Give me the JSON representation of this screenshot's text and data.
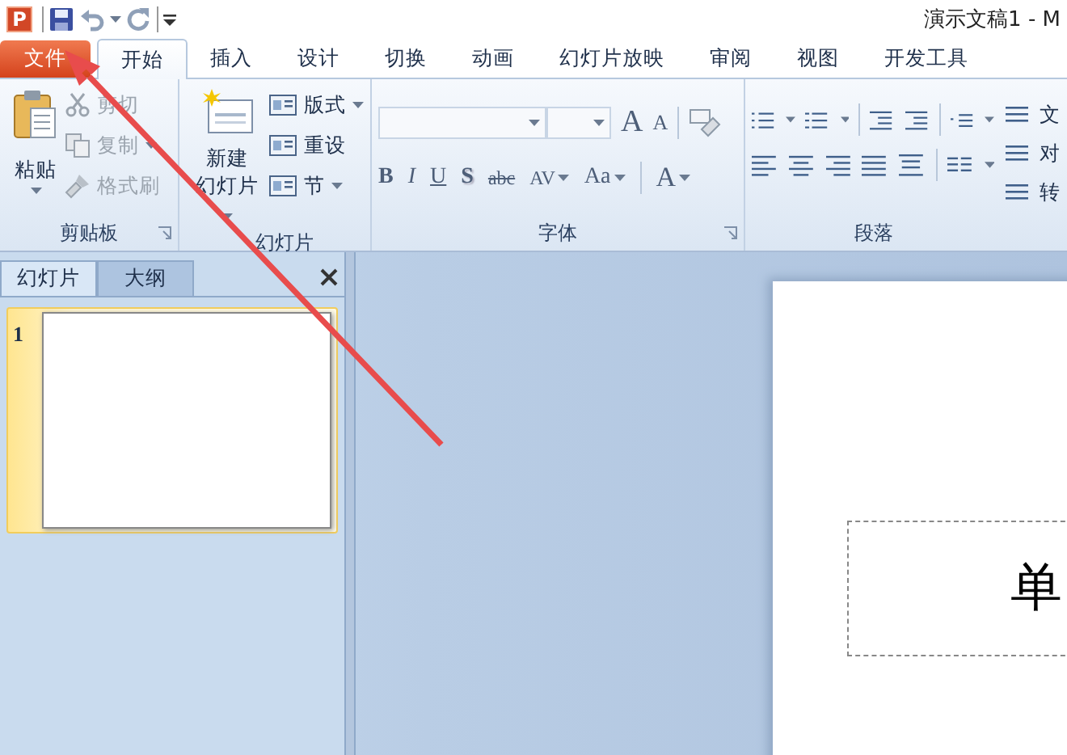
{
  "app_icon": {
    "letter": "P"
  },
  "window": {
    "title": "演示文稿1 - M"
  },
  "tabs": [
    {
      "label": "文件",
      "kind": "file",
      "selected": false
    },
    {
      "label": "开始",
      "kind": "tab",
      "selected": true
    },
    {
      "label": "插入",
      "kind": "tab",
      "selected": false
    },
    {
      "label": "设计",
      "kind": "tab",
      "selected": false
    },
    {
      "label": "切换",
      "kind": "tab",
      "selected": false
    },
    {
      "label": "动画",
      "kind": "tab",
      "selected": false
    },
    {
      "label": "幻灯片放映",
      "kind": "tab",
      "selected": false
    },
    {
      "label": "审阅",
      "kind": "tab",
      "selected": false
    },
    {
      "label": "视图",
      "kind": "tab",
      "selected": false
    },
    {
      "label": "开发工具",
      "kind": "tab",
      "selected": false
    }
  ],
  "clipboard": {
    "label": "剪贴板",
    "paste": "粘贴",
    "commands": [
      {
        "label": "剪切",
        "kind": "cut",
        "disabled": true,
        "dropdown": false
      },
      {
        "label": "复制",
        "kind": "copy",
        "disabled": true,
        "dropdown": true
      },
      {
        "label": "格式刷",
        "kind": "brush",
        "disabled": true,
        "dropdown": false
      }
    ]
  },
  "slides_group": {
    "label": "幻灯片",
    "new_slide": [
      "新建",
      "幻灯片"
    ],
    "commands": [
      {
        "label": "版式",
        "dropdown": true
      },
      {
        "label": "重设",
        "dropdown": false
      },
      {
        "label": "节",
        "dropdown": true
      }
    ]
  },
  "font": {
    "label": "字体",
    "size_buttons": [
      {
        "label": "A",
        "kind": "grow"
      },
      {
        "label": "A",
        "kind": "shrink"
      }
    ],
    "format_buttons": [
      {
        "label": "B",
        "kind": "bold",
        "dropdown": false
      },
      {
        "label": "I",
        "kind": "italic",
        "dropdown": false
      },
      {
        "label": "U",
        "kind": "underline",
        "dropdown": false
      },
      {
        "label": "S",
        "kind": "shadow",
        "dropdown": false
      },
      {
        "label": "abc",
        "kind": "strike",
        "dropdown": false
      },
      {
        "label": "AV",
        "kind": "spacing",
        "dropdown": true
      },
      {
        "label": "Aa",
        "kind": "case",
        "dropdown": true
      },
      {
        "label": "A",
        "kind": "color",
        "dropdown": true
      }
    ]
  },
  "paragraph": {
    "label": "段落",
    "side_commands": [
      {
        "label": "文"
      },
      {
        "label": "对"
      },
      {
        "label": "转"
      }
    ]
  },
  "slide_pane": {
    "tabs": [
      {
        "label": "幻灯片",
        "selected": true
      },
      {
        "label": "大纲",
        "selected": false
      }
    ],
    "thumbnails": [
      {
        "number": "1",
        "selected": true
      }
    ]
  },
  "slide": {
    "title_placeholder": "单"
  }
}
